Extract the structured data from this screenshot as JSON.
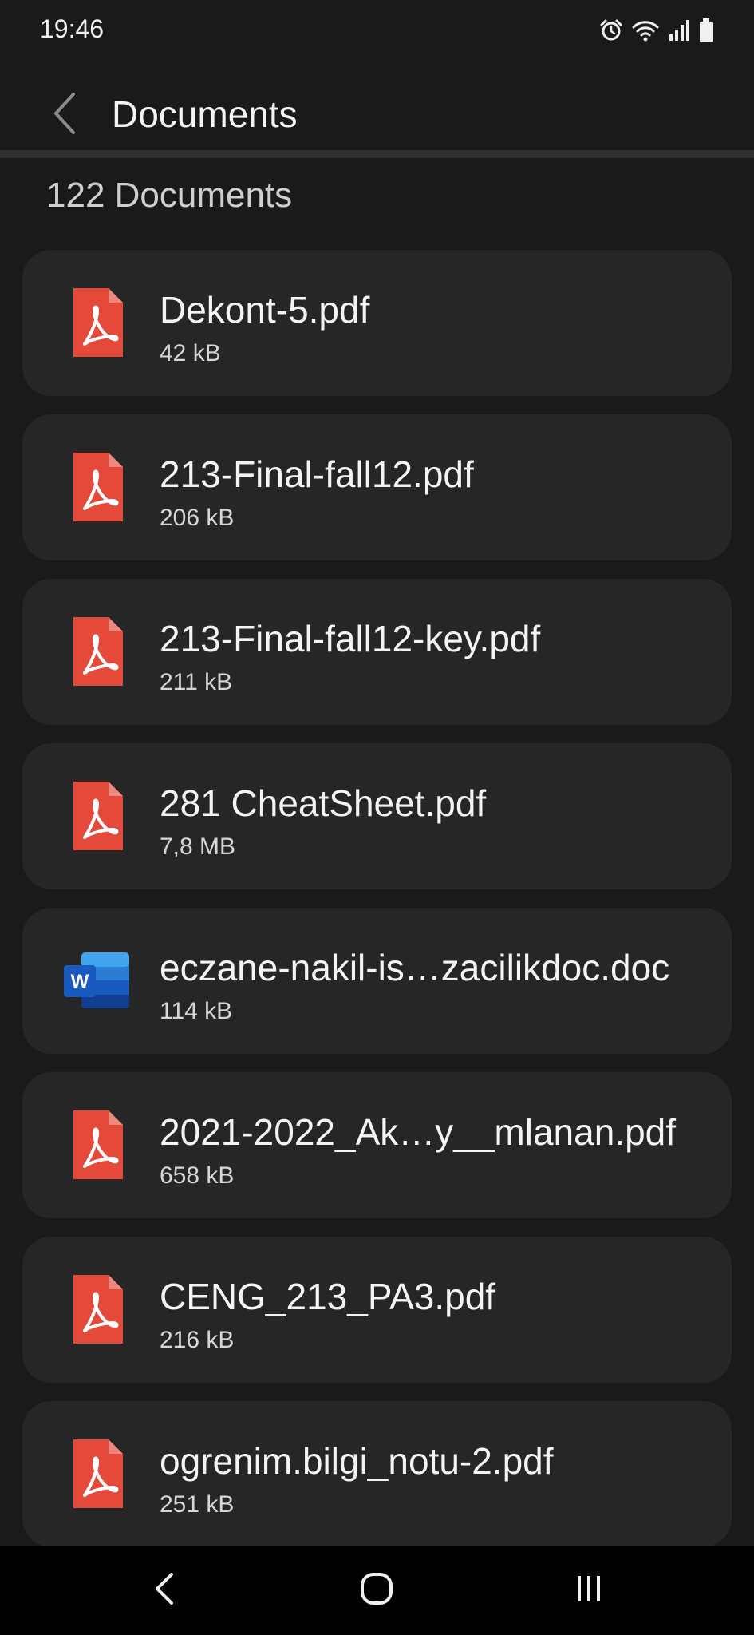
{
  "status_bar": {
    "time": "19:46",
    "icons": [
      "alarm-icon",
      "wifi-icon",
      "signal-icon",
      "battery-icon"
    ]
  },
  "header": {
    "title": "Documents",
    "back_icon": "chevron-left-icon"
  },
  "summary": {
    "count_label": "122 Documents"
  },
  "documents": [
    {
      "name": "Dekont-5.pdf",
      "size": "42 kB",
      "type": "pdf"
    },
    {
      "name": "213-Final-fall12.pdf",
      "size": "206 kB",
      "type": "pdf"
    },
    {
      "name": "213-Final-fall12-key.pdf",
      "size": "211 kB",
      "type": "pdf"
    },
    {
      "name": "281 CheatSheet.pdf",
      "size": "7,8 MB",
      "type": "pdf"
    },
    {
      "name": "eczane-nakil-is…zacilikdoc.doc",
      "size": "114 kB",
      "type": "word"
    },
    {
      "name": "2021-2022_Ak…y__mlanan.pdf",
      "size": "658 kB",
      "type": "pdf"
    },
    {
      "name": "CENG_213_PA3.pdf",
      "size": "216 kB",
      "type": "pdf"
    },
    {
      "name": "ogrenim.bilgi_notu-2.pdf",
      "size": "251 kB",
      "type": "pdf"
    }
  ],
  "nav_bar": {
    "buttons": [
      "back-icon",
      "home-icon",
      "recents-icon"
    ]
  },
  "colors": {
    "background": "#1a1a1a",
    "card": "#262626",
    "pdf_red": "#e5493a",
    "word_blue": "#185abd"
  }
}
